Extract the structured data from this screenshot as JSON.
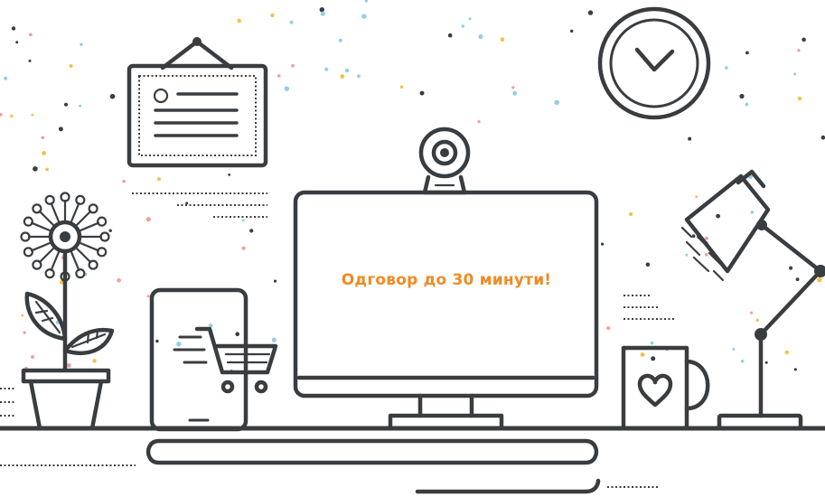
{
  "monitor": {
    "screen_text": "Одговор до 30 минути!"
  },
  "colors": {
    "line": "#3a3d40",
    "text_accent": "#f08a24",
    "confetti": [
      "#f5c04a",
      "#8fd0e6",
      "#3a3d40",
      "#f0a0a0"
    ]
  },
  "icons": [
    "certificate-icon",
    "clock-icon",
    "webcam-icon",
    "desk-lamp-icon",
    "flower-pot-icon",
    "tablet-cart-icon",
    "mug-heart-icon"
  ]
}
